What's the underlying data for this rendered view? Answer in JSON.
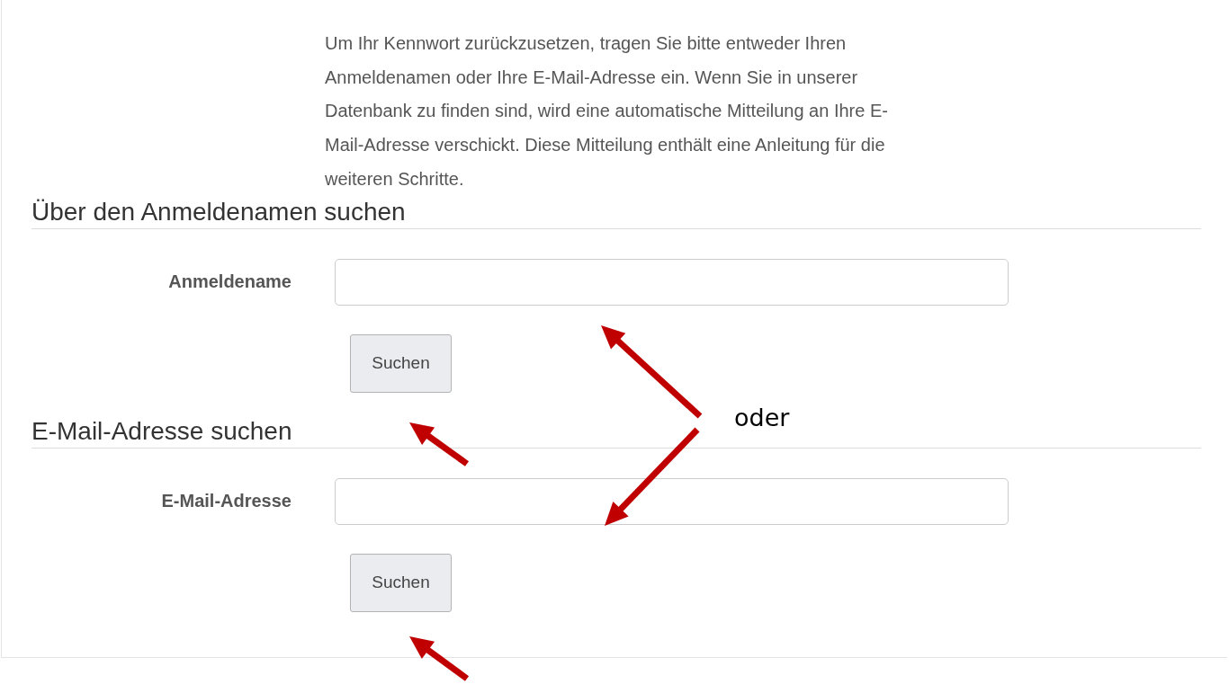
{
  "intro": "Um Ihr Kennwort zurückzusetzen, tragen Sie bitte entweder Ihren Anmeldenamen oder Ihre E-Mail-Adresse ein. Wenn Sie in unserer Datenbank zu finden sind, wird eine automatische Mitteilung an Ihre E-Mail-Adresse verschickt. Diese Mitteilung enthält eine Anleitung für die weiteren Schritte.",
  "sections": [
    {
      "heading": "Über den Anmeldenamen suchen",
      "label": "Anmeldename",
      "button": "Suchen"
    },
    {
      "heading": "E-Mail-Adresse suchen",
      "label": "E-Mail-Adresse",
      "button": "Suchen"
    }
  ],
  "annotation": {
    "label": "oder"
  }
}
